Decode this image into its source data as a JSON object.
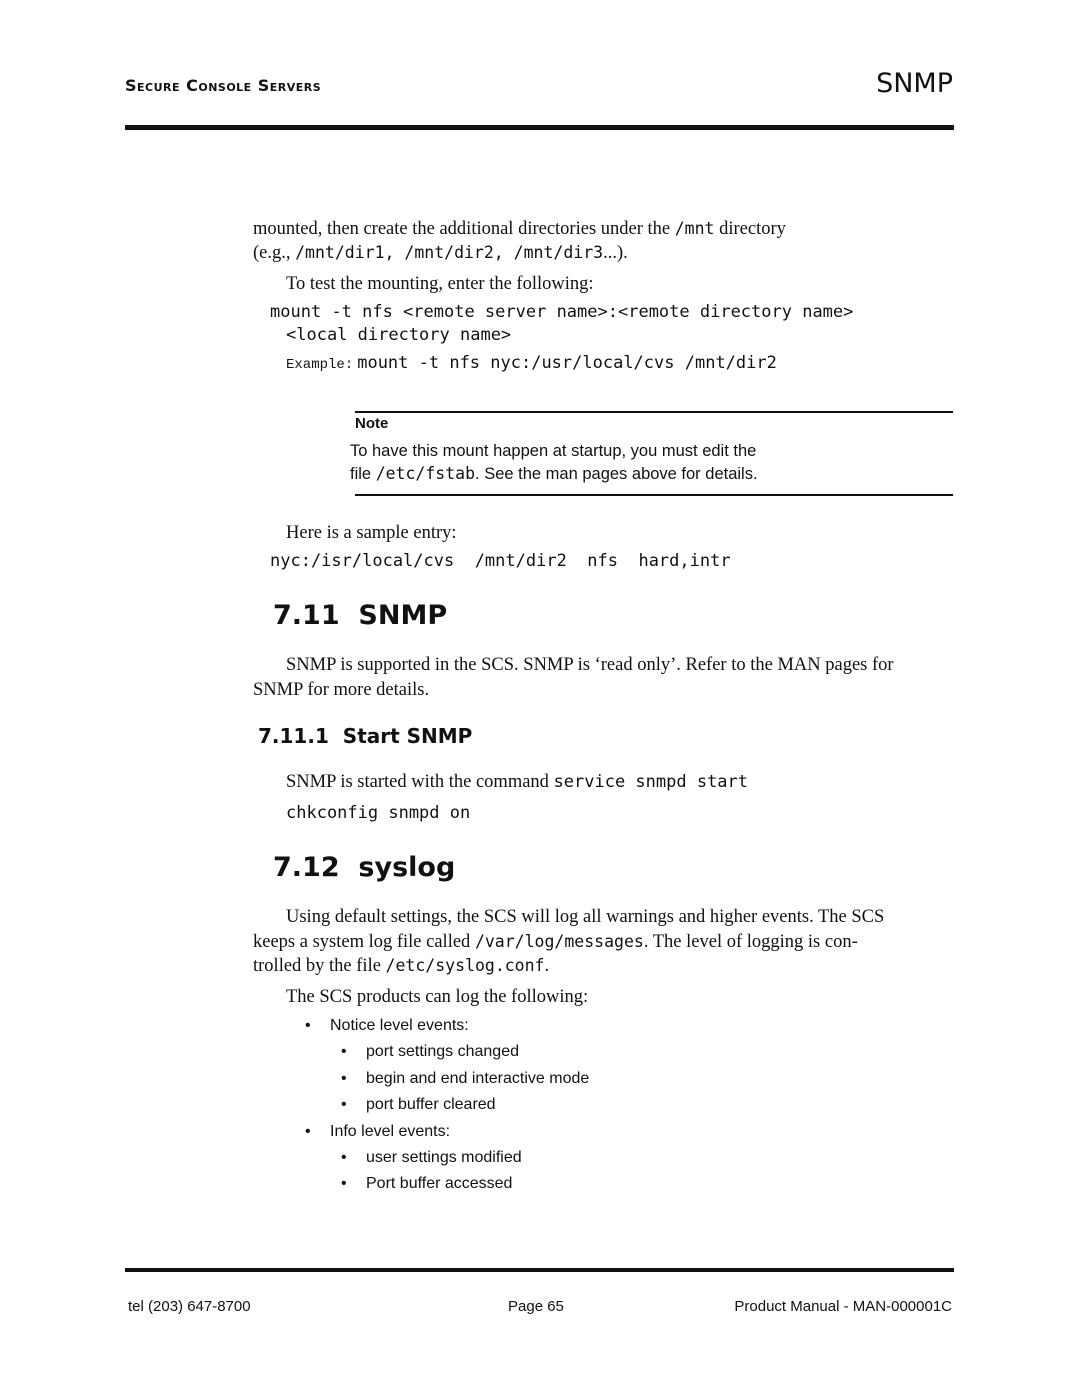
{
  "header": {
    "left": "Secure Console Servers",
    "right": "SNMP"
  },
  "intro": {
    "line1_text": "mounted, then create the additional directories under the ",
    "line1_code": "/mnt",
    "line1_end": " directory",
    "line2_start": "(e.g., ",
    "line2_code": "/mnt/dir1, /mnt/dir2, /mnt/dir3",
    "line2_end": "...).",
    "test_text": "To test the mounting, enter the following:",
    "cmd_line1": "mount -t nfs <remote server name>:<remote directory name>",
    "cmd_line2": "<local directory name>",
    "example_label": "Example:",
    "example_cmd": "mount -t nfs nyc:/usr/local/cvs /mnt/dir2"
  },
  "note": {
    "title": "Note",
    "line1": "To have this mount happen at startup, you must edit the",
    "line2_start": "file ",
    "line2_code": "/etc/fstab",
    "line2_end": ". See the man pages above for details."
  },
  "sample": {
    "text": "Here is a sample entry:",
    "entry": "nyc:/isr/local/cvs  /mnt/dir2  nfs  hard,intr"
  },
  "snmp": {
    "heading": "7.11  SNMP",
    "para_line1": "SNMP is supported in the SCS. SNMP is ‘read only’. Refer to the MAN pages for",
    "para_line2": "SNMP for more details.",
    "sub_heading": "7.11.1  Start SNMP",
    "start_text": "SNMP is started with the command ",
    "start_code": "service snmpd start",
    "chkconfig": "chkconfig snmpd on"
  },
  "syslog": {
    "heading": "7.12  syslog",
    "p1_line1": "Using default settings, the SCS will log all warnings and higher events. The SCS",
    "p1_line2_start": "keeps a system log file called ",
    "p1_line2_code": "/var/log/messages",
    "p1_line2_end": ". The level of logging is con-",
    "p1_line3_start": "trolled by the file ",
    "p1_line3_code": "/etc/syslog.conf",
    "p1_line3_end": ".",
    "p2": "The SCS products can log the following:",
    "notice_label": "Notice level events:",
    "notice_items": [
      "port settings changed",
      "begin and end interactive mode",
      "port buffer cleared"
    ],
    "info_label": "Info level events:",
    "info_items": [
      "user settings modified",
      "Port buffer accessed"
    ]
  },
  "footer": {
    "left": "tel (203) 647-8700",
    "center": "Page 65",
    "right": "Product Manual - MAN-000001C"
  }
}
